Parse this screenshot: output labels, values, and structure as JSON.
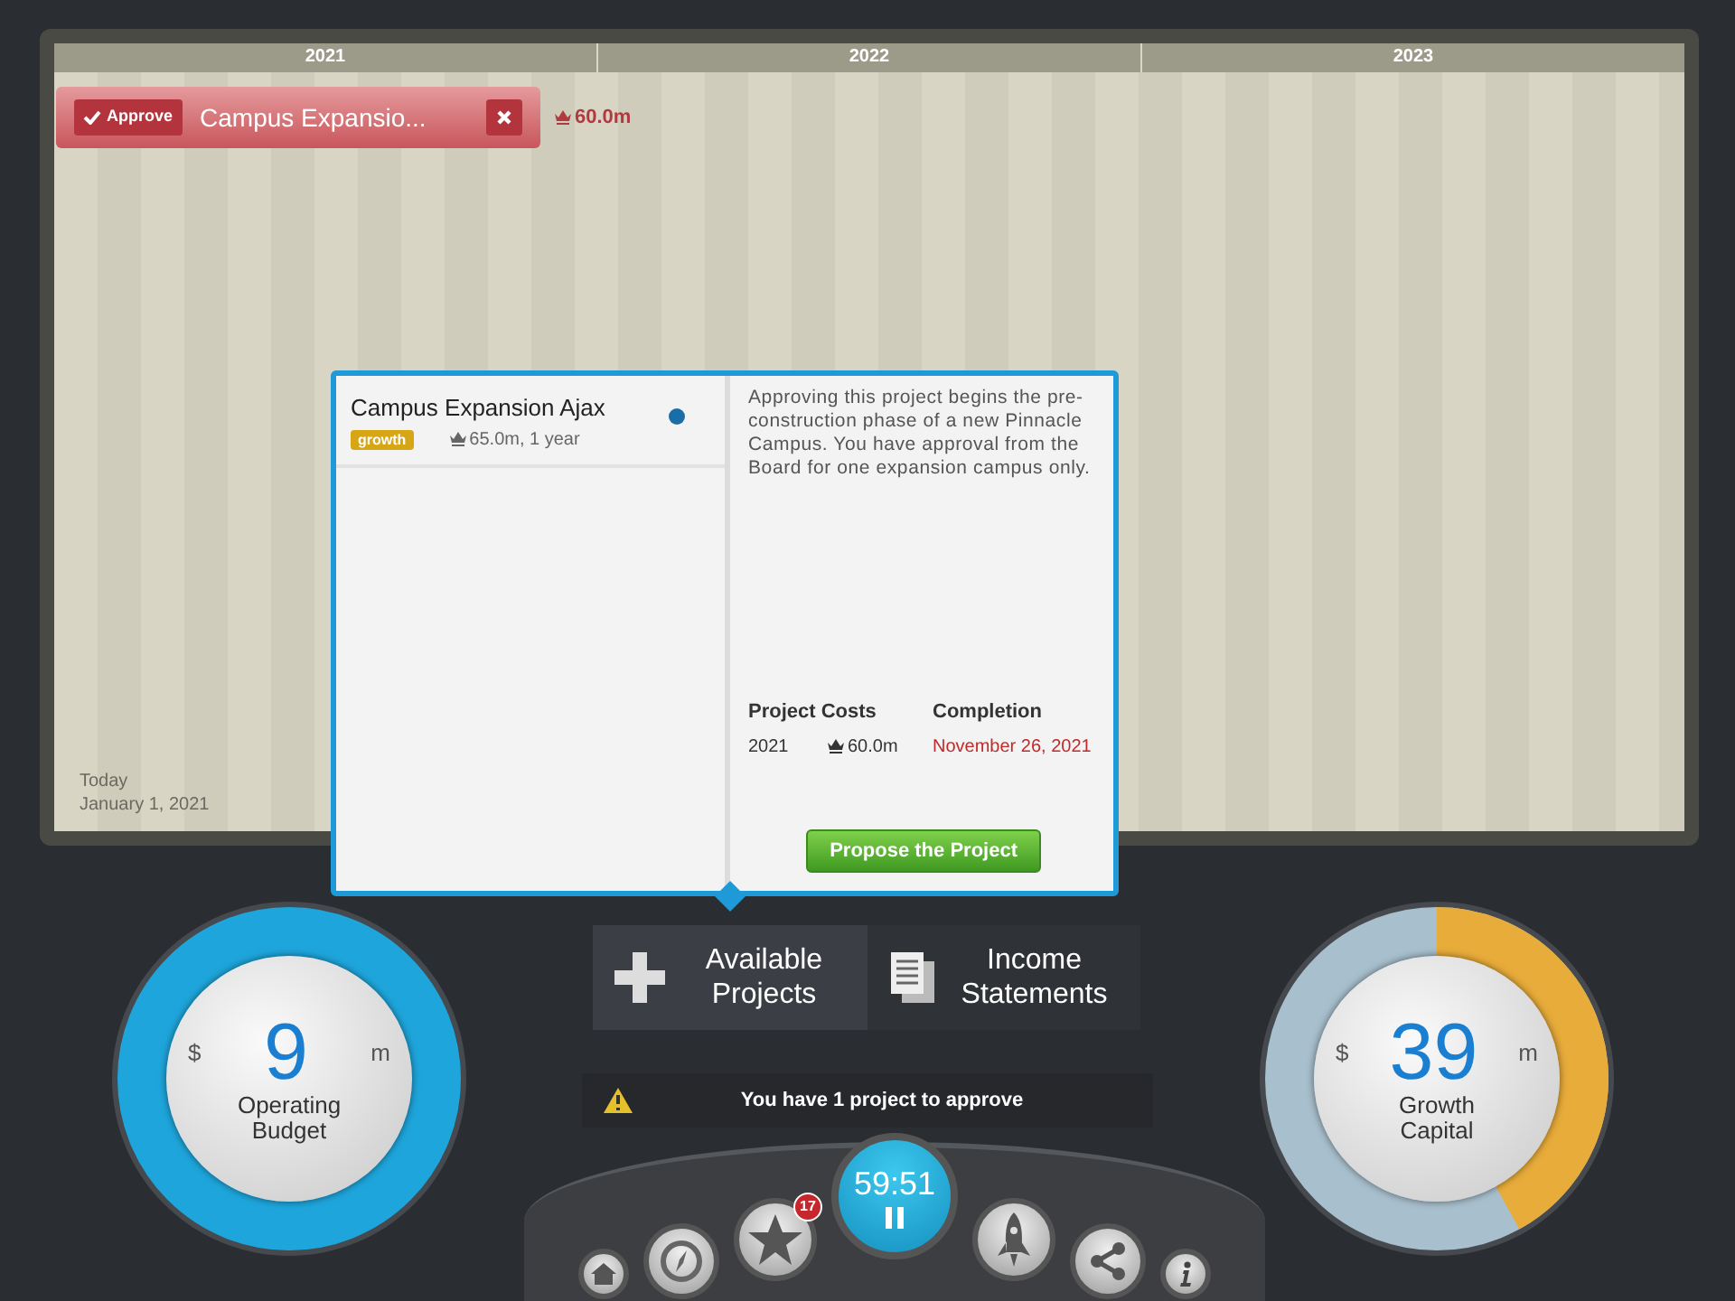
{
  "timeline": {
    "years": [
      "2021",
      "2022",
      "2023"
    ],
    "pending": [
      {
        "approve": "Approve",
        "title": "Campus Expansio...",
        "cost": "60.0m"
      }
    ],
    "today_label": "Today",
    "today_date": "January 1, 2021"
  },
  "popover": {
    "projects": [
      {
        "name": "Campus Expansion Ajax",
        "tag": "growth",
        "meta": "65.0m, 1 year",
        "selected": true
      }
    ],
    "description": "Approving this project begins the pre-construction phase of a new Pinnacle Campus. You have approval from the Board for one expansion campus only.",
    "cost_heading": "Project Costs",
    "completion_heading": "Completion",
    "costs": [
      {
        "year": "2021",
        "amount": "60.0m",
        "completion": "November 26, 2021"
      }
    ],
    "button": "Propose the Project"
  },
  "gauges": [
    {
      "kind": "budget",
      "prefix": "$",
      "value": "9",
      "unit": "m",
      "label": "Operating Budget"
    },
    {
      "kind": "capital",
      "prefix": "$",
      "value": "39",
      "unit": "m",
      "label": "Growth Capital",
      "level": 0.42
    }
  ],
  "actions": [
    {
      "kind": "add",
      "label": "Available Projects"
    },
    {
      "kind": "statements",
      "label": "Income Statements"
    }
  ],
  "alert": "You have 1 project to approve",
  "dock": {
    "badge": "17",
    "timer": "59:51"
  }
}
